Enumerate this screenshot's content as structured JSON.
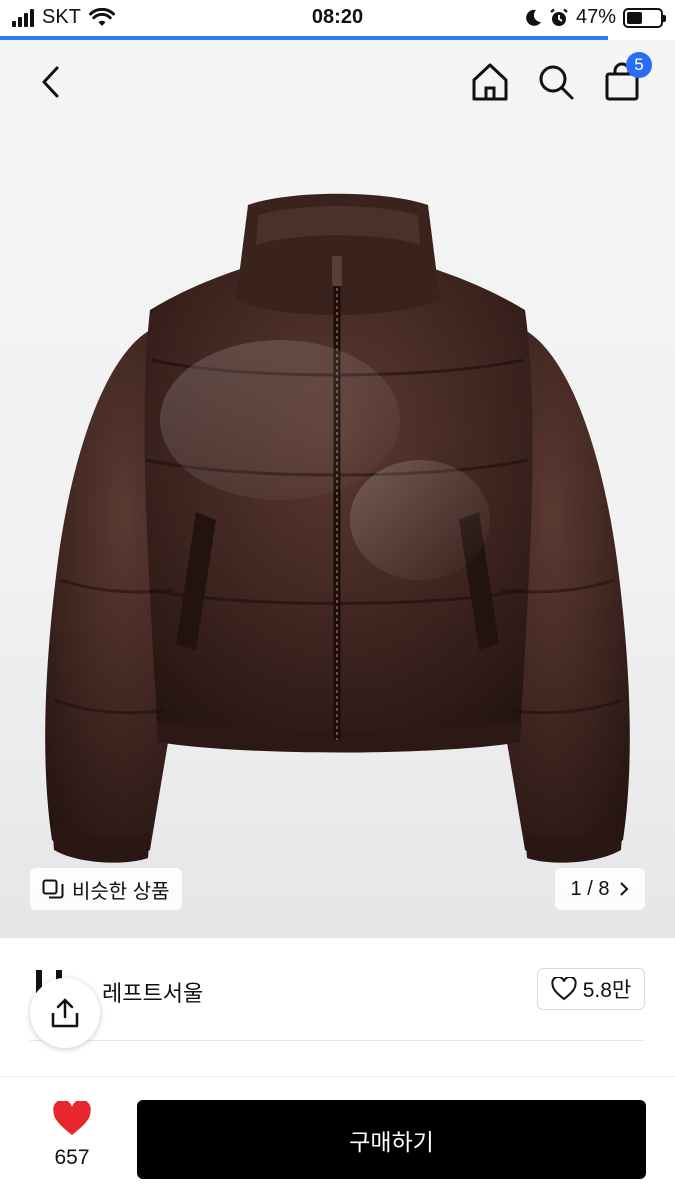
{
  "status_bar": {
    "carrier": "SKT",
    "time": "08:20",
    "battery": "47%",
    "battery_level": 0.47,
    "icons": [
      "signal-icon",
      "wifi-icon",
      "moon-icon",
      "alarm-icon",
      "battery-icon"
    ]
  },
  "page_load_progress": 0.9,
  "header": {
    "cart_count": "5",
    "icons": [
      "back-arrow-icon",
      "home-icon",
      "search-icon",
      "shopping-bag-icon"
    ]
  },
  "gallery": {
    "similar_label": "비슷한 상품",
    "page_current": "1",
    "page_separator": "/",
    "page_total": "8",
    "icons": [
      "similar-items-icon",
      "chevron-right-icon"
    ]
  },
  "seller": {
    "name": "레프트서울",
    "likes": "5.8만",
    "icons": [
      "heart-outline-icon",
      "share-icon"
    ]
  },
  "bottom_bar": {
    "like_count": "657",
    "buy_label": "구매하기",
    "icons": [
      "heart-filled-icon"
    ]
  },
  "colors": {
    "accent_blue": "#2b6cf6",
    "buy_button": "#000000",
    "heart_red": "#e8262d",
    "jacket_brown": "#3b221d"
  }
}
